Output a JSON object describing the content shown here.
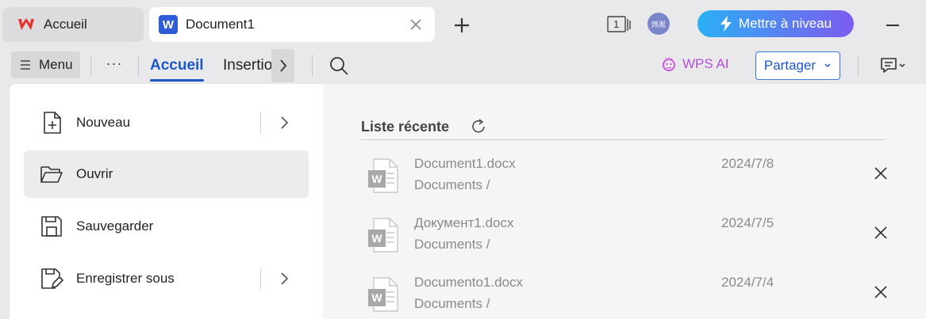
{
  "tabs": {
    "home_label": "Accueil",
    "doc_label": "Document1",
    "doc_logo_letter": "W"
  },
  "titlebar": {
    "page_count": "1",
    "avatar_text": "炜淞",
    "upgrade_label": "Mettre à niveau"
  },
  "toolbar": {
    "menu_label": "Menu",
    "more_label": "···",
    "tabs": [
      {
        "label": "Accueil",
        "active": true
      },
      {
        "label": "Insertion",
        "active": false
      }
    ],
    "wps_ai_label": "WPS AI",
    "share_label": "Partager"
  },
  "file_menu": {
    "items": [
      {
        "label": "Nouveau",
        "icon": "new-file-icon",
        "has_submenu": true
      },
      {
        "label": "Ouvrir",
        "icon": "open-folder-icon",
        "has_submenu": false,
        "selected": true
      },
      {
        "label": "Sauvegarder",
        "icon": "save-icon",
        "has_submenu": false
      },
      {
        "label": "Enregistrer sous",
        "icon": "save-as-icon",
        "has_submenu": true
      }
    ]
  },
  "recent": {
    "title": "Liste récente",
    "files": [
      {
        "name": "Document1.docx",
        "path": "Documents /",
        "date": "2024/7/8"
      },
      {
        "name": "Документ1.docx",
        "path": "Documents /",
        "date": "2024/7/5"
      },
      {
        "name": "Documento1.docx",
        "path": "Documents /",
        "date": "2024/7/4"
      }
    ]
  },
  "colors": {
    "accent": "#1c57c8",
    "wps_red": "#e5322d",
    "ai_purple": "#b04fd6"
  }
}
